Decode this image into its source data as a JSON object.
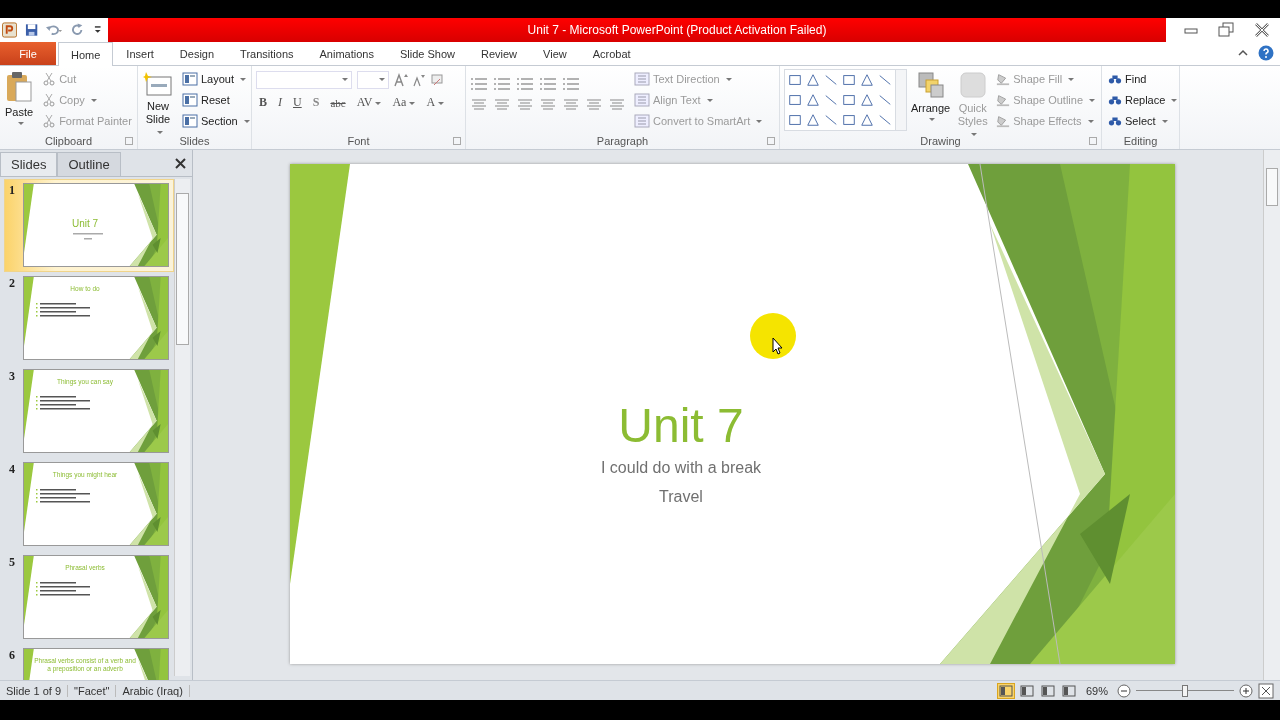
{
  "window": {
    "title": "Unit 7  -  Microsoft PowerPoint (Product Activation Failed)"
  },
  "file_tab": "File",
  "tabs": [
    {
      "label": "Home",
      "selected": true
    },
    {
      "label": "Insert",
      "selected": false
    },
    {
      "label": "Design",
      "selected": false
    },
    {
      "label": "Transitions",
      "selected": false
    },
    {
      "label": "Animations",
      "selected": false
    },
    {
      "label": "Slide Show",
      "selected": false
    },
    {
      "label": "Review",
      "selected": false
    },
    {
      "label": "View",
      "selected": false
    },
    {
      "label": "Acrobat",
      "selected": false
    }
  ],
  "groups": [
    {
      "label": "Clipboard",
      "buttons": [
        {
          "label": "Paste",
          "dropdown": true,
          "disabled": false
        },
        {
          "label": "Cut",
          "dropdown": false,
          "disabled": true
        },
        {
          "label": "Copy",
          "dropdown": true,
          "disabled": true
        },
        {
          "label": "Format Painter",
          "dropdown": false,
          "disabled": true
        }
      ]
    },
    {
      "label": "Slides",
      "buttons": [
        {
          "label": "New Slide",
          "dropdown": true,
          "disabled": false
        },
        {
          "label": "Layout",
          "dropdown": true,
          "disabled": false
        },
        {
          "label": "Reset",
          "dropdown": false,
          "disabled": false
        },
        {
          "label": "Section",
          "dropdown": true,
          "disabled": false
        }
      ]
    },
    {
      "label": "Font",
      "buttons": [
        {
          "label": "B",
          "dropdown": false,
          "disabled": false
        },
        {
          "label": "I",
          "dropdown": false,
          "disabled": false
        },
        {
          "label": "U",
          "dropdown": false,
          "disabled": false
        },
        {
          "label": "S",
          "dropdown": false,
          "disabled": false
        },
        {
          "label": "abc",
          "dropdown": false,
          "disabled": false
        },
        {
          "label": "AV",
          "dropdown": true,
          "disabled": false
        },
        {
          "label": "Aa",
          "dropdown": true,
          "disabled": false
        },
        {
          "label": "A",
          "dropdown": true,
          "disabled": false
        }
      ]
    },
    {
      "label": "Paragraph",
      "buttons": [
        {
          "label": "Text Direction",
          "dropdown": true,
          "disabled": true
        },
        {
          "label": "Align Text",
          "dropdown": true,
          "disabled": true
        },
        {
          "label": "Convert to SmartArt",
          "dropdown": true,
          "disabled": true
        }
      ]
    },
    {
      "label": "Drawing",
      "buttons": [
        {
          "label": "Arrange",
          "dropdown": true,
          "disabled": false
        },
        {
          "label": "Quick Styles",
          "dropdown": true,
          "disabled": true
        },
        {
          "label": "Shape Fill",
          "dropdown": true,
          "disabled": true
        },
        {
          "label": "Shape Outline",
          "dropdown": true,
          "disabled": true
        },
        {
          "label": "Shape Effects",
          "dropdown": true,
          "disabled": true
        }
      ]
    },
    {
      "label": "Editing",
      "buttons": [
        {
          "label": "Find",
          "dropdown": false,
          "disabled": false
        },
        {
          "label": "Replace",
          "dropdown": true,
          "disabled": false
        },
        {
          "label": "Select",
          "dropdown": true,
          "disabled": false
        }
      ]
    }
  ],
  "pane_tabs": [
    {
      "label": "Slides",
      "selected": true
    },
    {
      "label": "Outline",
      "selected": false
    }
  ],
  "thumbnails": [
    {
      "number": "1",
      "kind": "title",
      "title": "Unit 7",
      "selected": true
    },
    {
      "number": "2",
      "kind": "content",
      "title": "How to do",
      "selected": false
    },
    {
      "number": "3",
      "kind": "content",
      "title": "Things you can say",
      "selected": false
    },
    {
      "number": "4",
      "kind": "content",
      "title": "Things you might hear",
      "selected": false
    },
    {
      "number": "5",
      "kind": "content",
      "title": "Phrasal verbs",
      "selected": false
    },
    {
      "number": "6",
      "kind": "heading",
      "title": "Phrasal verbs consist of a verb and a preposition or an adverb",
      "selected": false
    }
  ],
  "slide": {
    "title": "Unit 7",
    "subtitle": [
      "I could do with a break",
      "Travel"
    ]
  },
  "status": {
    "slide": "Slide 1 of 9",
    "theme": "\"Facet\"",
    "language": "Arabic (Iraq)",
    "views": [
      {
        "selected": true
      },
      {
        "selected": false
      },
      {
        "selected": false
      },
      {
        "selected": false
      }
    ],
    "zoom": "69%",
    "zoom_slider": {
      "level": 0.5
    }
  }
}
